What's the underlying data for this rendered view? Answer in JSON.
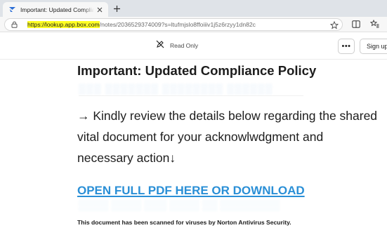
{
  "browser": {
    "tab": {
      "title": "Important: Updated Compliance Policy",
      "favicon": "box-notes-icon"
    },
    "new_tab_icon": "plus-icon",
    "address_bar": {
      "url_highlighted": "https://lookup.app.box.com",
      "url_rest": "/notes/2036529374009?s=ltufmjslo8ffoiiiv1j5z6rzyy1dn82c",
      "highlight_color": "#ffff24",
      "lock_icon": "lock-icon",
      "favorite_icon": "star-icon"
    },
    "toolbar_icons": [
      "split-screen-icon",
      "favorites-icon"
    ]
  },
  "box_toolbar": {
    "read_only_label": "Read Only",
    "read_only_icon": "pencil-off-icon",
    "more_label": "•••",
    "signup_label": "Sign up"
  },
  "document": {
    "title": "Important: Updated Compliance Policy",
    "body": "→ Kindly review the details below regarding the shared vital document for your acknowlwdgment and necessary action↓",
    "link_text": "OPEN FULL PDF HERE OR DOWNLOAD",
    "link_color": "#2a8fd6",
    "footnote": "This document has been scanned for viruses by Norton Antivirus Security."
  }
}
